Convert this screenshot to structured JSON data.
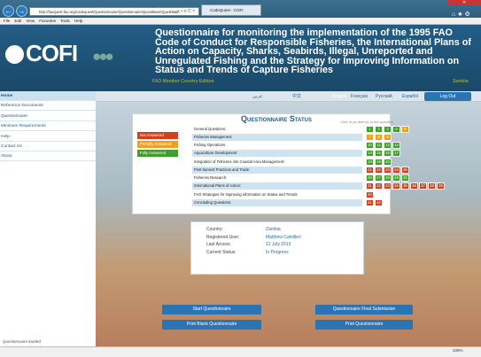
{
  "browser": {
    "address": "http://faoquest.fao.org/codequest/Questionnaire/Questionnaire/QuestMain/QuestMain",
    "address_controls": "⌕ ▾ ⊘ C ×",
    "tab_title": "CodeQuest - COFI",
    "menu": [
      "File",
      "Edit",
      "View",
      "Favorites",
      "Tools",
      "Help"
    ]
  },
  "header": {
    "logo": "COFI",
    "title": "Questionnaire for monitoring the implementation of the 1995 FAO Code of Conduct for Responsible Fisheries, the International Plans of Action on Capacity, Sharks, Seabirds, Illegal, Unreported and Unregulated Fishing and the Strategy for Improving Information on Status and Trends of Capture Fisheries",
    "member_label": "FAO Member Country Edition",
    "country": "Zambia"
  },
  "sidebar": {
    "items": [
      "Home",
      "Reference Documents",
      "Questionnaire",
      "Minimum Requirements",
      "Help",
      "Contact Us",
      "About"
    ]
  },
  "languages": [
    "عربي",
    "中文",
    "English",
    "Français",
    "Pycский",
    "Español"
  ],
  "logout_label": "Log Out",
  "questionnaire": {
    "title": "Questionnaire Status",
    "hint": "Click to go directly to the question",
    "legend": [
      "Not Answered",
      "Partially Answered",
      "Fully Answered"
    ],
    "rows": [
      {
        "label": "General Questions:",
        "sections": [
          "1",
          "2",
          "3",
          "4",
          "5"
        ]
      },
      {
        "label": "Fisheries Management",
        "sections": [
          "7",
          "8",
          "9"
        ]
      },
      {
        "label": "Fishing Operations",
        "sections": [
          "10",
          "11",
          "12",
          "13"
        ]
      },
      {
        "label": "Aquaculture Development",
        "sections": [
          "14",
          "15",
          "16",
          "17"
        ]
      },
      {
        "label": "Integration of Fisheries into Coastal Area Management:",
        "sections": [
          "18",
          "19",
          "20"
        ]
      },
      {
        "label": "Post-harvest Practices and Trade:",
        "sections": [
          "21",
          "22",
          "23",
          "24",
          "25"
        ]
      },
      {
        "label": "Fisheries Research:",
        "sections": [
          "26",
          "27",
          "28",
          "29",
          "30"
        ]
      },
      {
        "label": "International Plans of Action:",
        "sections": [
          "31",
          "32",
          "33",
          "34",
          "35",
          "36",
          "37",
          "38",
          "39"
        ]
      },
      {
        "label": "FAO Strategies for improving information on Status and Trends",
        "sections": [
          "40"
        ]
      },
      {
        "label": "Concluding Questions:",
        "sections": [
          "41",
          "42"
        ]
      }
    ]
  },
  "colors": {
    "not_answered": "#d2401c",
    "partially": "#f0a01c",
    "fully": "#3f9e2c"
  },
  "info": {
    "labels": [
      "Country:",
      "Registered User:",
      "Last Access:",
      "Current Status:"
    ],
    "values": [
      "Zambia",
      "Matthew Camilleri",
      "12 July 2013",
      "In Progress"
    ]
  },
  "buttons": {
    "start": "Start Questionnaire",
    "final": "Questionnaire Final Submission",
    "print_blank": "Print Blank Questionnaire",
    "print": "Print Questionnaire"
  },
  "status": {
    "text": "Questionnaire loaded",
    "zoom": "105%"
  }
}
